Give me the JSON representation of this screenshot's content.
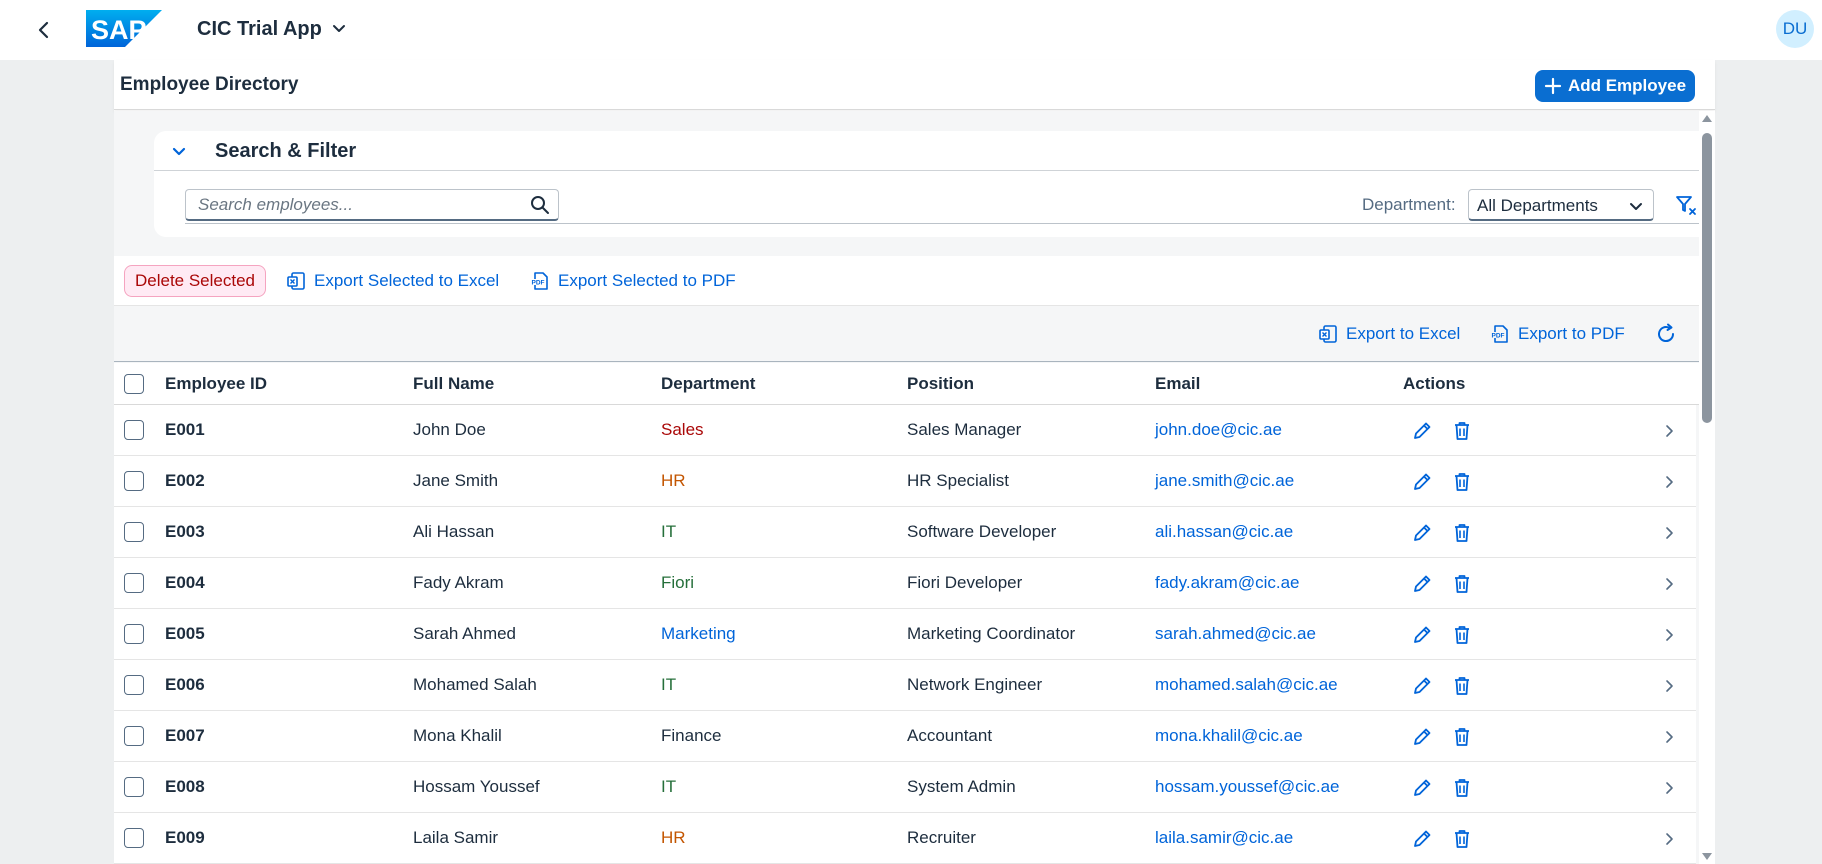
{
  "shell": {
    "app_title": "CIC Trial App",
    "logo_text": "SAP",
    "avatar_initials": "DU"
  },
  "page": {
    "title": "Employee Directory",
    "add_button": "Add Employee"
  },
  "filter": {
    "title": "Search & Filter",
    "search_placeholder": "Search employees...",
    "department_label": "Department:",
    "department_value": "All Departments"
  },
  "toolbar": {
    "delete_selected": "Delete Selected",
    "export_selected_excel": "Export Selected to Excel",
    "export_selected_pdf": "Export Selected to PDF",
    "export_excel": "Export to Excel",
    "export_pdf": "Export to PDF"
  },
  "table": {
    "columns": [
      "Employee ID",
      "Full Name",
      "Department",
      "Position",
      "Email",
      "Actions"
    ],
    "rows": [
      {
        "id": "E001",
        "name": "John Doe",
        "dept": "Sales",
        "dept_color": "#aa0808",
        "position": "Sales Manager",
        "email": "john.doe@cic.ae"
      },
      {
        "id": "E002",
        "name": "Jane Smith",
        "dept": "HR",
        "dept_color": "#c35500",
        "position": "HR Specialist",
        "email": "jane.smith@cic.ae"
      },
      {
        "id": "E003",
        "name": "Ali Hassan",
        "dept": "IT",
        "dept_color": "#256f3a",
        "position": "Software Developer",
        "email": "ali.hassan@cic.ae"
      },
      {
        "id": "E004",
        "name": "Fady Akram",
        "dept": "Fiori",
        "dept_color": "#256f3a",
        "position": "Fiori Developer",
        "email": "fady.akram@cic.ae"
      },
      {
        "id": "E005",
        "name": "Sarah Ahmed",
        "dept": "Marketing",
        "dept_color": "#0064d9",
        "position": "Marketing Coordinator",
        "email": "sarah.ahmed@cic.ae"
      },
      {
        "id": "E006",
        "name": "Mohamed Salah",
        "dept": "IT",
        "dept_color": "#256f3a",
        "position": "Network Engineer",
        "email": "mohamed.salah@cic.ae"
      },
      {
        "id": "E007",
        "name": "Mona Khalil",
        "dept": "Finance",
        "dept_color": "#1d2d3e",
        "position": "Accountant",
        "email": "mona.khalil@cic.ae"
      },
      {
        "id": "E008",
        "name": "Hossam Youssef",
        "dept": "IT",
        "dept_color": "#256f3a",
        "position": "System Admin",
        "email": "hossam.youssef@cic.ae"
      },
      {
        "id": "E009",
        "name": "Laila Samir",
        "dept": "HR",
        "dept_color": "#c35500",
        "position": "Recruiter",
        "email": "laila.samir@cic.ae"
      }
    ]
  },
  "colors": {
    "accent": "#0a6ed1",
    "link": "#0064d9",
    "danger": "#aa0808"
  }
}
